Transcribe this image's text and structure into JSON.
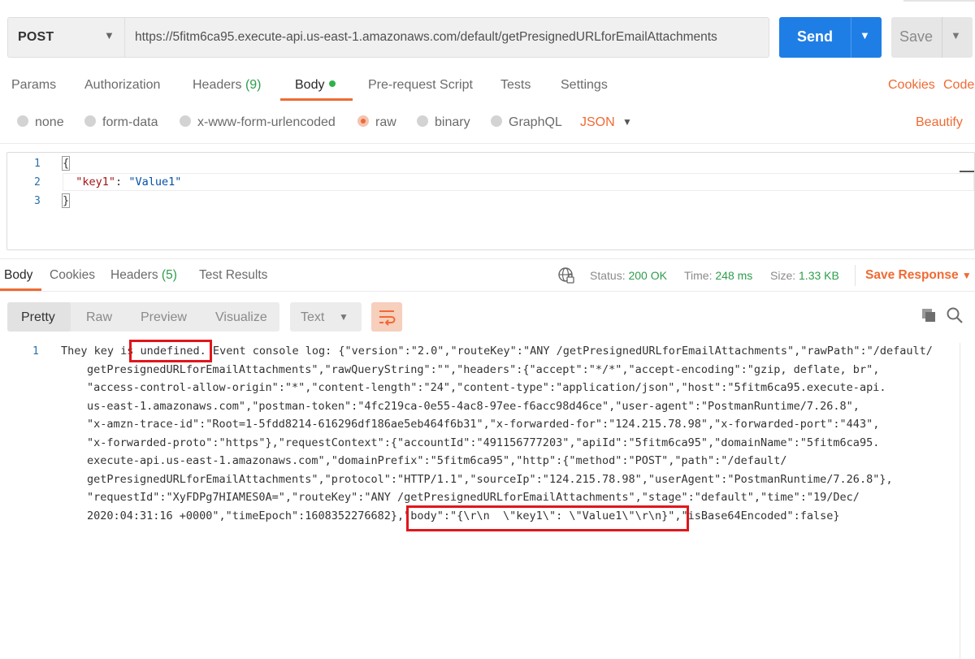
{
  "request": {
    "method": "POST",
    "url": "https://5fitm6ca95.execute-api.us-east-1.amazonaws.com/default/getPresignedURLforEmailAttachments",
    "send_label": "Send",
    "save_label": "Save"
  },
  "request_tabs": {
    "params": "Params",
    "authorization": "Authorization",
    "headers": "Headers",
    "headers_count": "(9)",
    "body": "Body",
    "prerequest": "Pre-request Script",
    "tests": "Tests",
    "settings": "Settings",
    "cookies": "Cookies",
    "code": "Code"
  },
  "body_types": {
    "none": "none",
    "form_data": "form-data",
    "urlencoded": "x-www-form-urlencoded",
    "raw": "raw",
    "binary": "binary",
    "graphql": "GraphQL",
    "selected": "raw",
    "format": "JSON",
    "beautify": "Beautify"
  },
  "editor": {
    "line_numbers": [
      "1",
      "2",
      "3"
    ],
    "open_brace": "{",
    "key": "\"key1\"",
    "colon": ": ",
    "value": "\"Value1\"",
    "close_brace": "}"
  },
  "response_tabs": {
    "body": "Body",
    "cookies": "Cookies",
    "headers": "Headers",
    "headers_count": "(5)",
    "test_results": "Test Results"
  },
  "response_meta": {
    "status_label": "Status:",
    "status_value": "200 OK",
    "time_label": "Time:",
    "time_value": "248 ms",
    "size_label": "Size:",
    "size_value": "1.33 KB",
    "save_response": "Save Response"
  },
  "response_toolbar": {
    "pretty": "Pretty",
    "raw": "Raw",
    "preview": "Preview",
    "visualize": "Visualize",
    "text_format": "Text"
  },
  "response_body": {
    "line_number": "1",
    "lines": [
      "They key is undefined. Event console log: {\"version\":\"2.0\",\"routeKey\":\"ANY /getPresignedURLforEmailAttachments\",\"rawPath\":\"/default/",
      "getPresignedURLforEmailAttachments\",\"rawQueryString\":\"\",\"headers\":{\"accept\":\"*/*\",\"accept-encoding\":\"gzip, deflate, br\",",
      "\"access-control-allow-origin\":\"*\",\"content-length\":\"24\",\"content-type\":\"application/json\",\"host\":\"5fitm6ca95.execute-api.",
      "us-east-1.amazonaws.com\",\"postman-token\":\"4fc219ca-0e55-4ac8-97ee-f6acc98d46ce\",\"user-agent\":\"PostmanRuntime/7.26.8\",",
      "\"x-amzn-trace-id\":\"Root=1-5fdd8214-616296df186ae5eb464f6b31\",\"x-forwarded-for\":\"124.215.78.98\",\"x-forwarded-port\":\"443\",",
      "\"x-forwarded-proto\":\"https\"},\"requestContext\":{\"accountId\":\"491156777203\",\"apiId\":\"5fitm6ca95\",\"domainName\":\"5fitm6ca95.",
      "execute-api.us-east-1.amazonaws.com\",\"domainPrefix\":\"5fitm6ca95\",\"http\":{\"method\":\"POST\",\"path\":\"/default/",
      "getPresignedURLforEmailAttachments\",\"protocol\":\"HTTP/1.1\",\"sourceIp\":\"124.215.78.98\",\"userAgent\":\"PostmanRuntime/7.26.8\"},",
      "\"requestId\":\"XyFDPg7HIAMES0A=\",\"routeKey\":\"ANY /getPresignedURLforEmailAttachments\",\"stage\":\"default\",\"time\":\"19/Dec/",
      "2020:04:31:16 +0000\",\"timeEpoch\":1608352276682},\"body\":\"{\\r\\n  \\\"key1\\\": \\\"Value1\\\"\\r\\n}\",\"isBase64Encoded\":false}"
    ]
  },
  "colors": {
    "accent": "#f06a33",
    "send": "#1f7ee6",
    "success": "#2e9d4b",
    "highlight_box": "#e0161b"
  }
}
